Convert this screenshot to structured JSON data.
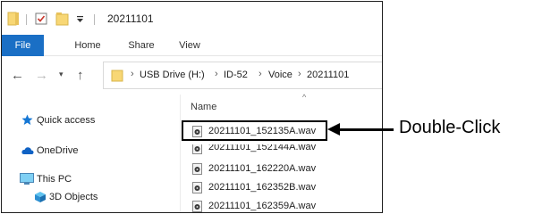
{
  "titlebar": {
    "title": "20211101"
  },
  "ribbon": {
    "tabs": [
      "File",
      "Home",
      "Share",
      "View"
    ]
  },
  "address": {
    "crumbs": [
      "USB Drive (H:)",
      "ID-52",
      "Voice",
      "20211101"
    ]
  },
  "list": {
    "column_name": "Name",
    "files": [
      "20211101_152135A.wav",
      "20211101_152144A.wav",
      "20211101_162220A.wav",
      "20211101_162352B.wav",
      "20211101_162359A.wav"
    ]
  },
  "sidebar": {
    "items": [
      {
        "label": "Quick access",
        "icon": "star-icon"
      },
      {
        "label": "OneDrive",
        "icon": "cloud-icon"
      },
      {
        "label": "This PC",
        "icon": "monitor-icon"
      },
      {
        "label": "3D Objects",
        "icon": "cube-icon"
      }
    ]
  },
  "annotation": {
    "label": "Double-Click"
  },
  "colors": {
    "file_tab": "#1a6fc5",
    "folder": "#f8d775",
    "onedrive": "#0f62c4",
    "star": "#1577d4"
  }
}
